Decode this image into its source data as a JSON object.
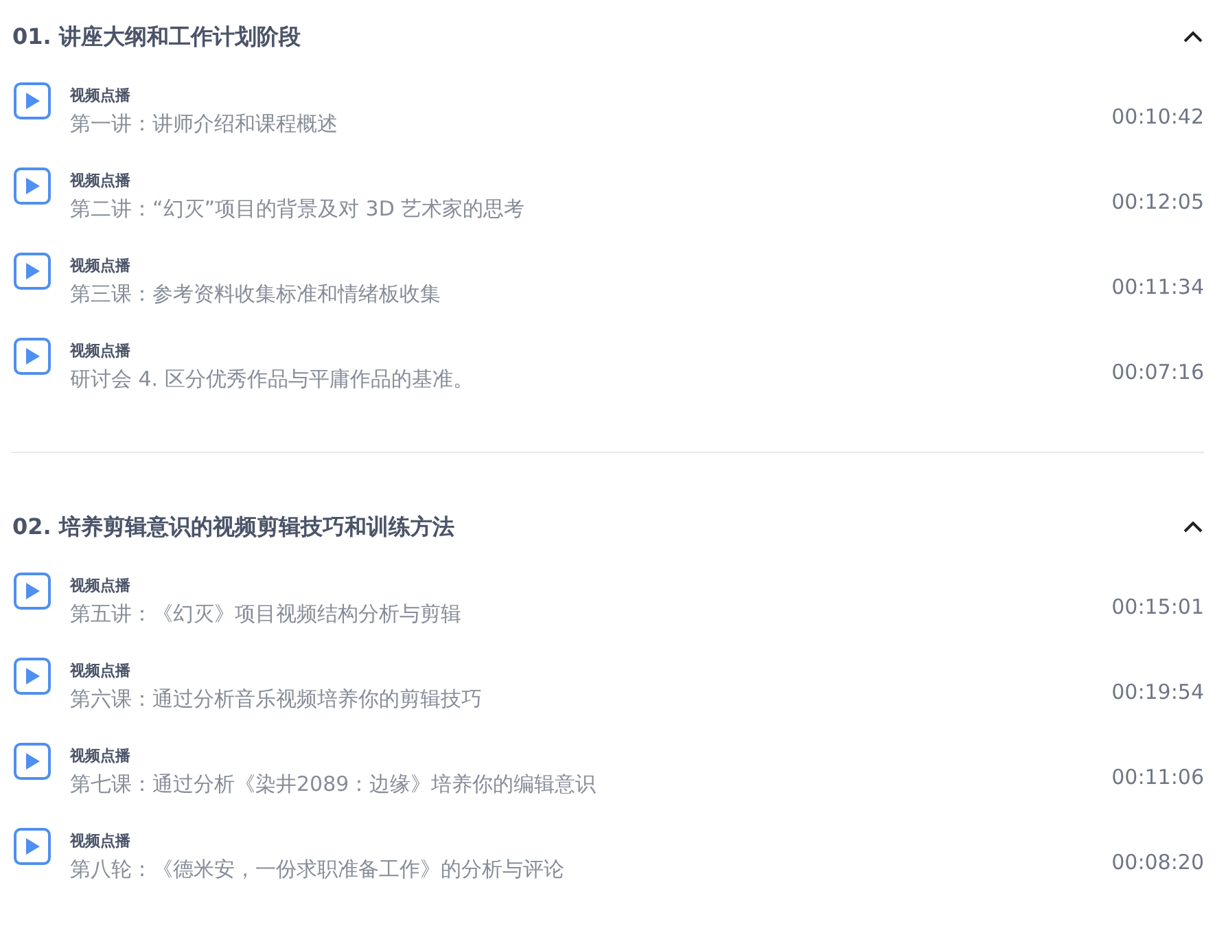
{
  "sections": [
    {
      "title": "01. 讲座大纲和工作计划阶段",
      "expanded": true,
      "items": [
        {
          "tag": "视频点播",
          "title": "第一讲：讲师介绍和课程概述",
          "duration": "00:10:42"
        },
        {
          "tag": "视频点播",
          "title": "第二讲：“幻灭”项目的背景及对 3D 艺术家的思考",
          "duration": "00:12:05"
        },
        {
          "tag": "视频点播",
          "title": "第三课：参考资料收集标准和情绪板收集",
          "duration": "00:11:34"
        },
        {
          "tag": "视频点播",
          "title": "研讨会 4. 区分优秀作品与平庸作品的基准。",
          "duration": "00:07:16"
        }
      ]
    },
    {
      "title": "02. 培养剪辑意识的视频剪辑技巧和训练方法",
      "expanded": true,
      "items": [
        {
          "tag": "视频点播",
          "title": "第五讲：《幻灭》项目视频结构分析与剪辑",
          "duration": "00:15:01"
        },
        {
          "tag": "视频点播",
          "title": "第六课：通过分析音乐视频培养你的剪辑技巧",
          "duration": "00:19:54"
        },
        {
          "tag": "视频点播",
          "title": "第七课：通过分析《染井2089：边缘》培养你的编辑意识",
          "duration": "00:11:06"
        },
        {
          "tag": "视频点播",
          "title": "第八轮：《德米安，一份求职准备工作》的分析与评论",
          "duration": "00:08:20"
        }
      ]
    }
  ]
}
